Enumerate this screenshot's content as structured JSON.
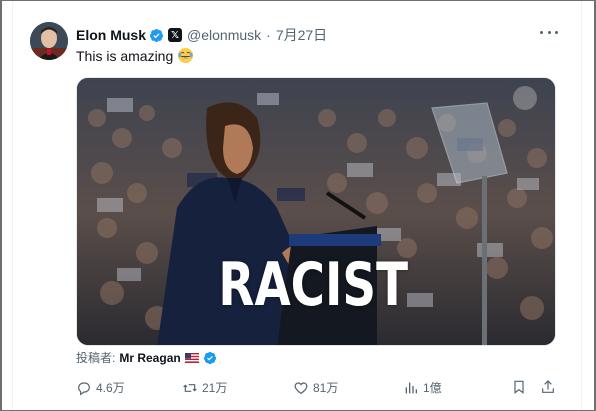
{
  "tweet": {
    "author_name": "Elon Musk",
    "author_handle": "@elonmusk",
    "separator": "·",
    "date": "7月27日",
    "text": "This is amazing",
    "emoji": "face-with-tears-of-joy",
    "media": {
      "overlay_text": "RACIST"
    },
    "attribution": {
      "prefix": "投稿者:",
      "name": "Mr Reagan",
      "flag": "us-flag"
    },
    "actions": {
      "replies": "4.6万",
      "reposts": "21万",
      "likes": "81万",
      "views": "1億"
    }
  },
  "colors": {
    "verified_blue": "#1d9bf0",
    "text_primary": "#0f1419",
    "text_secondary": "#536471"
  }
}
